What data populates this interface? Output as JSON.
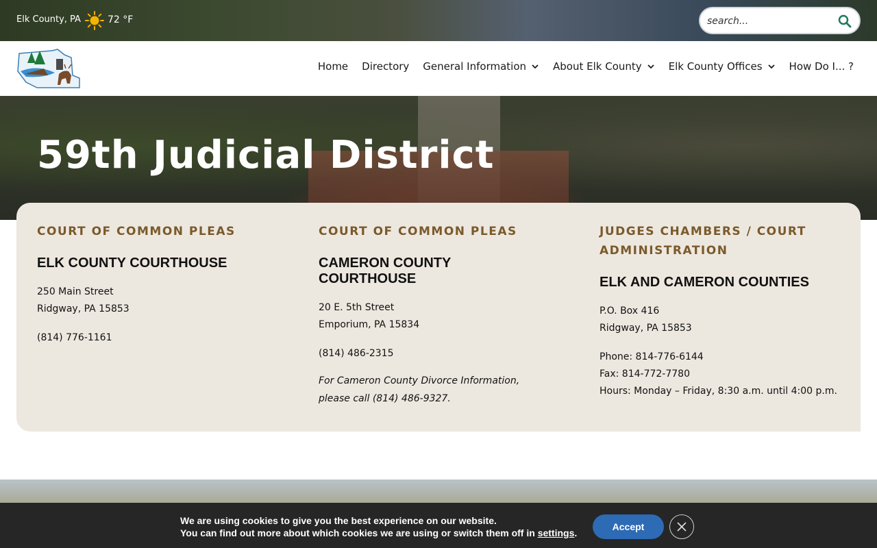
{
  "topbar": {
    "location": "Elk County, PA",
    "weather_icon": "sun-icon",
    "temperature": "72 °F",
    "search": {
      "placeholder": "search...",
      "icon": "search-icon"
    }
  },
  "nav": {
    "logo_alt": "Elk County logo",
    "items": [
      {
        "label": "Home",
        "has_dropdown": false
      },
      {
        "label": "Directory",
        "has_dropdown": false
      },
      {
        "label": "General Information",
        "has_dropdown": true
      },
      {
        "label": "About Elk County",
        "has_dropdown": true
      },
      {
        "label": "Elk County Offices",
        "has_dropdown": true
      },
      {
        "label": "How Do I... ?",
        "has_dropdown": false
      }
    ]
  },
  "hero": {
    "title": "59th Judicial District"
  },
  "card": {
    "columns": [
      {
        "eyebrow": "COURT OF COMMON PLEAS",
        "heading": "ELK COUNTY COURTHOUSE",
        "address_line1": "250 Main Street",
        "address_line2": "Ridgway, PA 15853",
        "phone": "(814) 776-1161"
      },
      {
        "eyebrow": "COURT OF COMMON PLEAS",
        "heading_line1": "CAMERON COUNTY",
        "heading_line2": "COURTHOUSE",
        "address_line1": "20 E. 5th Street",
        "address_line2": "Emporium, PA 15834",
        "phone": "(814) 486-2315",
        "note_line1": "For Cameron County Divorce Information,",
        "note_line2": "please call (814) 486-9327."
      },
      {
        "eyebrow_line1": "JUDGES CHAMBERS / COURT",
        "eyebrow_line2": "ADMINISTRATION",
        "heading": "ELK AND CAMERON COUNTIES",
        "address_line1": "P.O. Box 416",
        "address_line2": "Ridgway, PA 15853",
        "phone": "Phone: 814-776-6144",
        "fax": "Fax: 814-772-7780",
        "hours": "Hours: Monday – Friday, 8:30 a.m. until 4:00 p.m."
      }
    ]
  },
  "cookie": {
    "line1": "We are using cookies to give you the best experience on our website.",
    "line2_prefix": "You can find out more about which cookies we are using or switch them off in ",
    "settings_link": "settings",
    "line2_suffix": ".",
    "accept_label": "Accept",
    "close_icon": "close-icon"
  },
  "colors": {
    "accent_brown": "#7a5a2c",
    "card_bg": "#ede8df",
    "accept_blue": "#2d6bb5",
    "cookie_bg": "#262626",
    "search_icon_green": "#1f7a5a"
  }
}
